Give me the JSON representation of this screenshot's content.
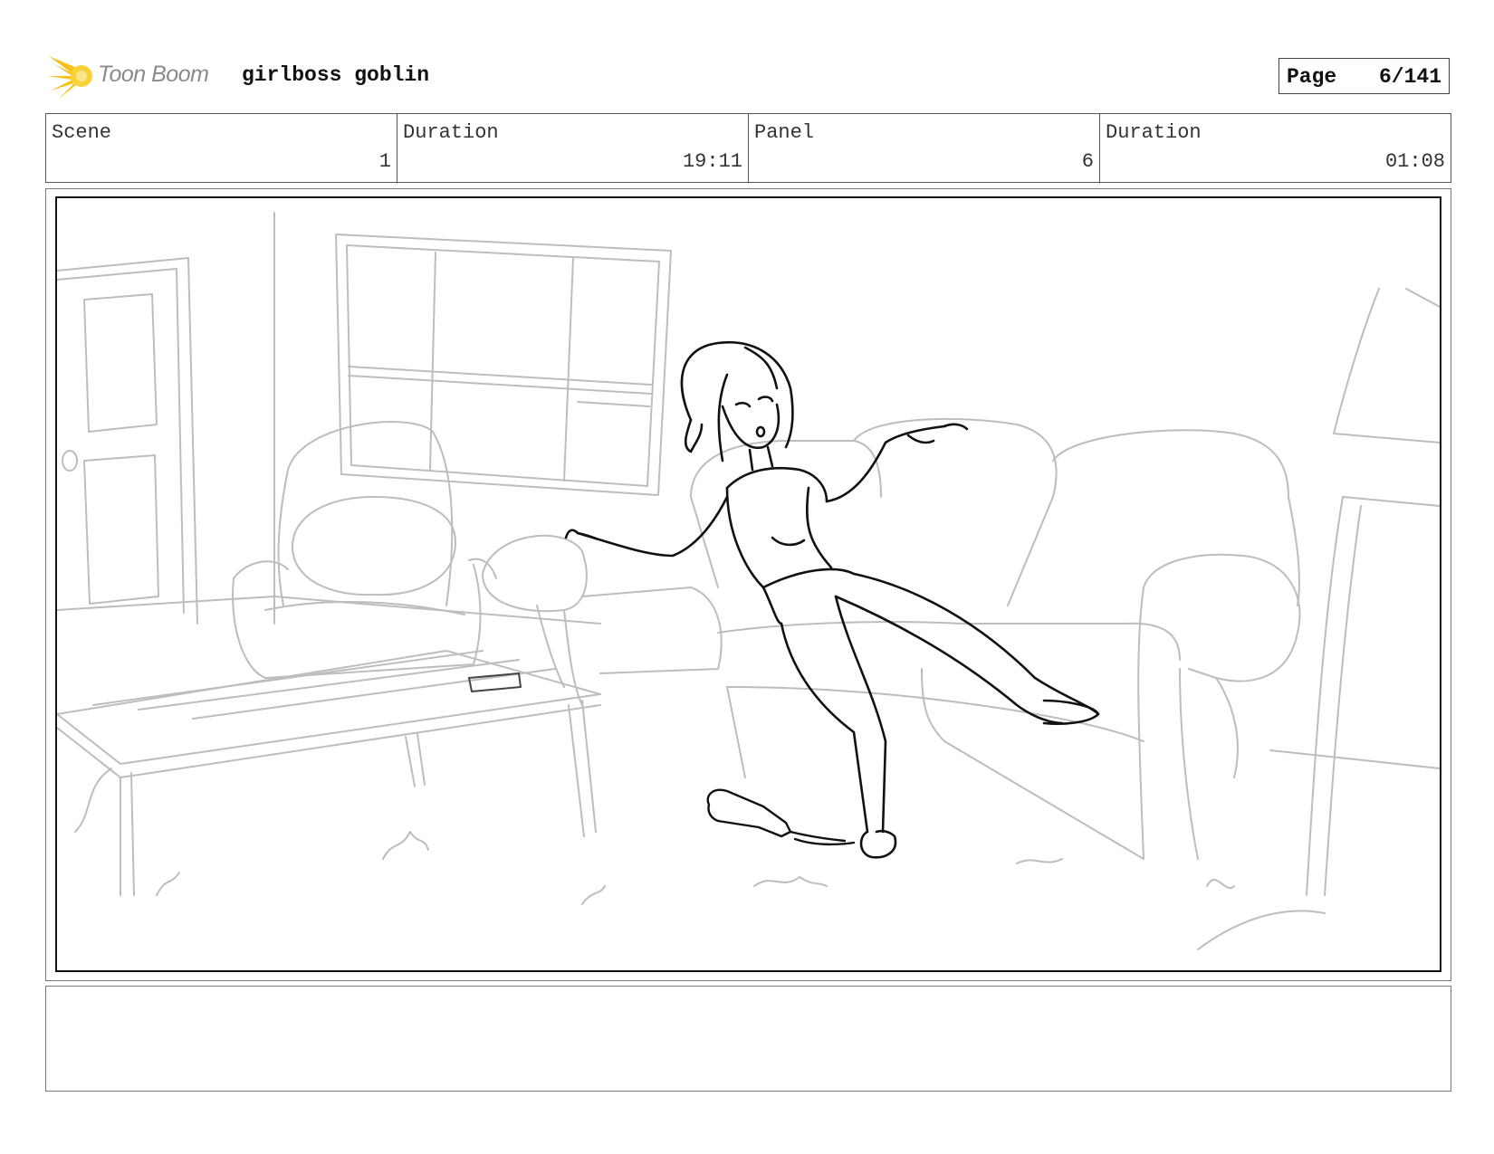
{
  "header": {
    "logo_text": "Toon Boom",
    "project_title": "girlboss goblin",
    "page_label": "Page",
    "page_value": "6/141"
  },
  "info": [
    {
      "label": "Scene",
      "value": "1"
    },
    {
      "label": "Duration",
      "value": "19:11"
    },
    {
      "label": "Panel",
      "value": "6"
    },
    {
      "label": "Duration",
      "value": "01:08"
    }
  ],
  "colors": {
    "logo_accent": "#f5c21b",
    "sketch_line": "#bdbdbd",
    "ink_line": "#111111"
  },
  "icons": {
    "logo": "toon-boom-star-icon"
  },
  "notes": {
    "text": ""
  }
}
